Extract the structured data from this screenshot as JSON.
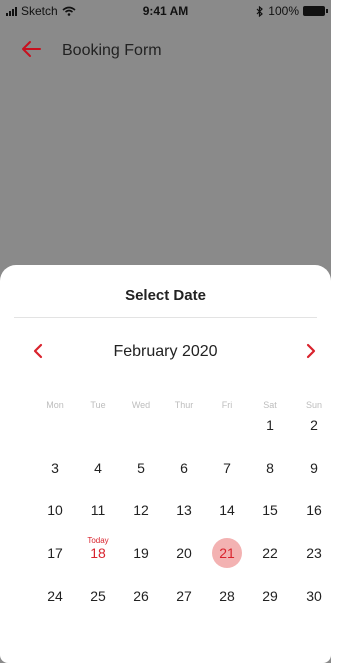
{
  "status_bar": {
    "carrier": "Sketch",
    "time": "9:41 AM",
    "battery": "100%"
  },
  "header": {
    "title": "Booking Form"
  },
  "sheet": {
    "title": "Select Date",
    "month_label": "February 2020",
    "weekdays": [
      "Mon",
      "Tue",
      "Wed",
      "Thur",
      "Fri",
      "Sat",
      "Sun"
    ],
    "today_label": "Today",
    "weeks": [
      [
        "",
        "",
        "",
        "",
        "",
        "1",
        "2"
      ],
      [
        "3",
        "4",
        "5",
        "6",
        "7",
        "8",
        "9"
      ],
      [
        "10",
        "11",
        "12",
        "13",
        "14",
        "15",
        "16"
      ],
      [
        "17",
        "18",
        "19",
        "20",
        "21",
        "22",
        "23"
      ],
      [
        "24",
        "25",
        "26",
        "27",
        "28",
        "29",
        "30"
      ]
    ],
    "today_day": "18",
    "selected_day": "21"
  },
  "colors": {
    "accent": "#d9232d",
    "selected_bg": "#f3b2b2",
    "overlay": "#8a8a8a"
  }
}
